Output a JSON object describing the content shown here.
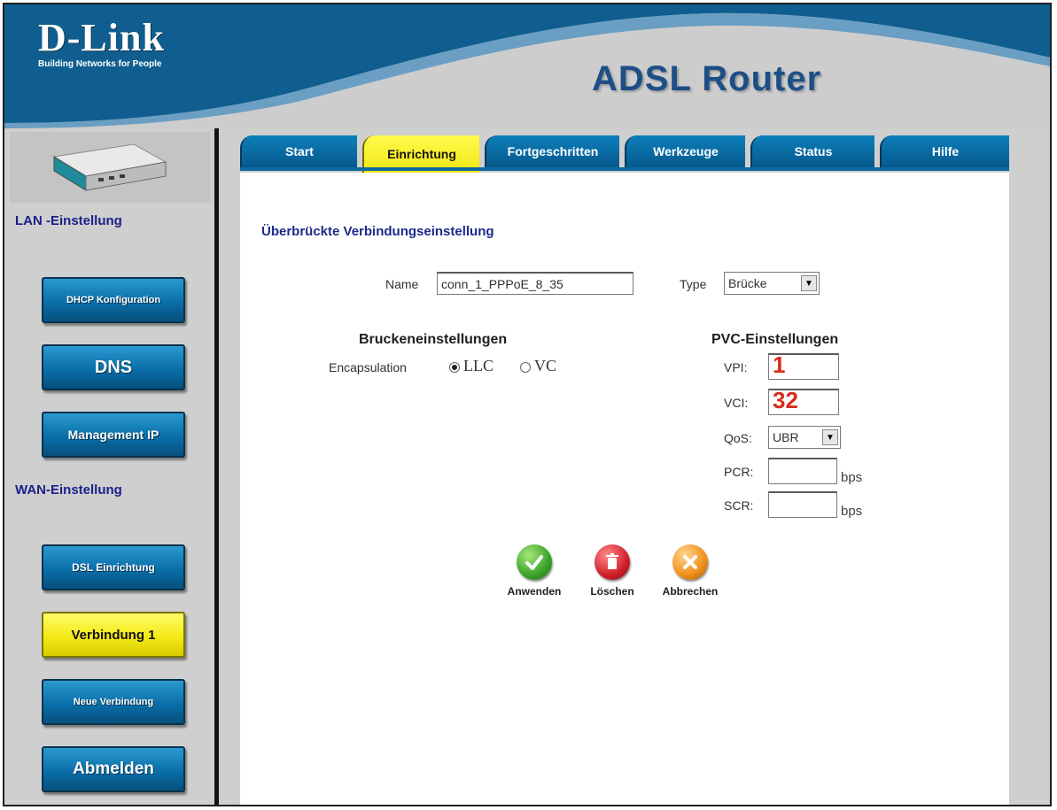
{
  "header": {
    "logo": "D-Link",
    "tagline": "Building Networks for People",
    "product": "ADSL Router"
  },
  "tabs": [
    {
      "label": "Start",
      "active": false
    },
    {
      "label": "Einrichtung",
      "active": true
    },
    {
      "label": "Fortgeschritten",
      "active": false
    },
    {
      "label": "Werkzeuge",
      "active": false
    },
    {
      "label": "Status",
      "active": false
    },
    {
      "label": "Hilfe",
      "active": false
    }
  ],
  "sidebar": {
    "lan_label": "LAN -Einstellung",
    "wan_label": "WAN-Einstellung",
    "buttons": {
      "dhcp": "DHCP Konfiguration",
      "dns": "DNS",
      "mgmt_ip": "Management IP",
      "dsl": "DSL Einrichtung",
      "verbindung1": "Verbindung 1",
      "neue": "Neue Verbindung",
      "abmelden": "Abmelden"
    }
  },
  "page": {
    "title": "Überbrückte Verbindungseinstellung",
    "name_label": "Name",
    "name_value": "conn_1_PPPoE_8_35",
    "type_label": "Type",
    "type_value": "Brücke",
    "bridge": {
      "heading": "Bruckeneinstellungen",
      "encap_label": "Encapsulation",
      "llc": "LLC",
      "vc": "VC",
      "selected": "LLC"
    },
    "pvc": {
      "heading": "PVC-Einstellungen",
      "vpi_label": "VPI:",
      "vpi_value": "1",
      "vci_label": "VCI:",
      "vci_value": "32",
      "qos_label": "QoS:",
      "qos_value": "UBR",
      "pcr_label": "PCR:",
      "scr_label": "SCR:",
      "unit": "bps"
    },
    "actions": {
      "apply": "Anwenden",
      "delete": "Löschen",
      "cancel": "Abbrechen"
    }
  },
  "colors": {
    "brand_blue": "#0a6ea8",
    "active_yellow": "#f3ea16",
    "title_navy": "#1b2a8a",
    "value_red": "#d62d1c"
  }
}
